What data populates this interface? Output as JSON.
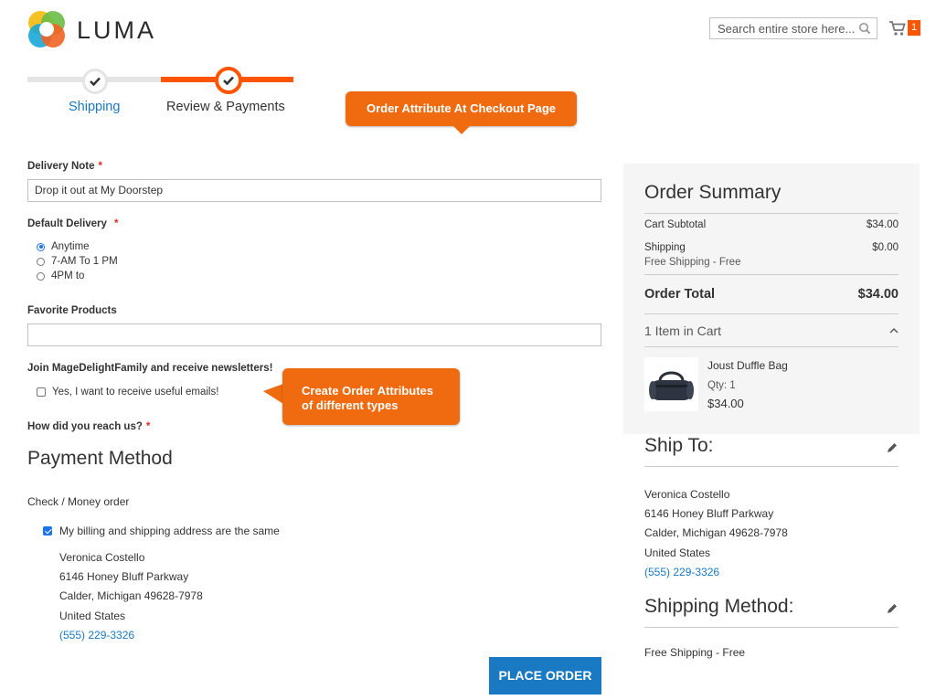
{
  "header": {
    "logo_text": "LUMA",
    "search_placeholder": "Search entire store here...",
    "cart_count": "1"
  },
  "progress": {
    "steps": [
      {
        "label": "Shipping",
        "state": "complete"
      },
      {
        "label": "Review & Payments",
        "state": "active"
      }
    ]
  },
  "callouts": {
    "top": "Order Attribute At Checkout Page",
    "side_line1": "Create Order Attributes",
    "side_line2": "of different types"
  },
  "form": {
    "delivery_note": {
      "label": "Delivery Note",
      "value": "Drop it out at My Doorstep",
      "required": "*"
    },
    "default_delivery": {
      "label": "Default Delivery",
      "required": "*",
      "options": [
        {
          "label": "Anytime",
          "selected": true
        },
        {
          "label": "7-AM To 1 PM",
          "selected": false
        },
        {
          "label": "4PM to",
          "selected": false
        }
      ]
    },
    "favorite_products": {
      "label": "Favorite Products",
      "value": ""
    },
    "newsletter": {
      "label": "Join MageDelightFamily and receive newsletters!",
      "option": "Yes, I want to receive useful emails!",
      "checked": false
    },
    "how_reach": {
      "label": "How did you reach us?",
      "required": "*"
    }
  },
  "payment": {
    "title": "Payment Method",
    "method": "Check / Money order",
    "same_address_label": "My billing and shipping address are the same",
    "same_address_checked": true,
    "address": {
      "name": "Veronica Costello",
      "street": "6146 Honey Bluff Parkway",
      "city": "Calder, Michigan 49628-7978",
      "country": "United States",
      "phone": "(555) 229-3326"
    },
    "place_order": "PLACE ORDER"
  },
  "summary": {
    "title": "Order Summary",
    "cart_subtotal_label": "Cart Subtotal",
    "cart_subtotal": "$34.00",
    "shipping_label": "Shipping",
    "shipping_value": "$0.00",
    "shipping_method": "Free Shipping - Free",
    "order_total_label": "Order Total",
    "order_total": "$34.00",
    "items_label": "1 Item in Cart",
    "item": {
      "name": "Joust Duffle Bag",
      "qty": "Qty: 1",
      "price": "$34.00"
    }
  },
  "ship_to": {
    "title": "Ship To:",
    "name": "Veronica Costello",
    "street": "6146 Honey Bluff Parkway",
    "city": "Calder, Michigan 49628-7978",
    "country": "United States",
    "phone": "(555) 229-3326"
  },
  "shipping_method": {
    "title": "Shipping Method:",
    "value": "Free Shipping - Free"
  },
  "colors": {
    "accent": "#ff5501",
    "primary": "#1979c3",
    "callout": "#f06a0f"
  }
}
